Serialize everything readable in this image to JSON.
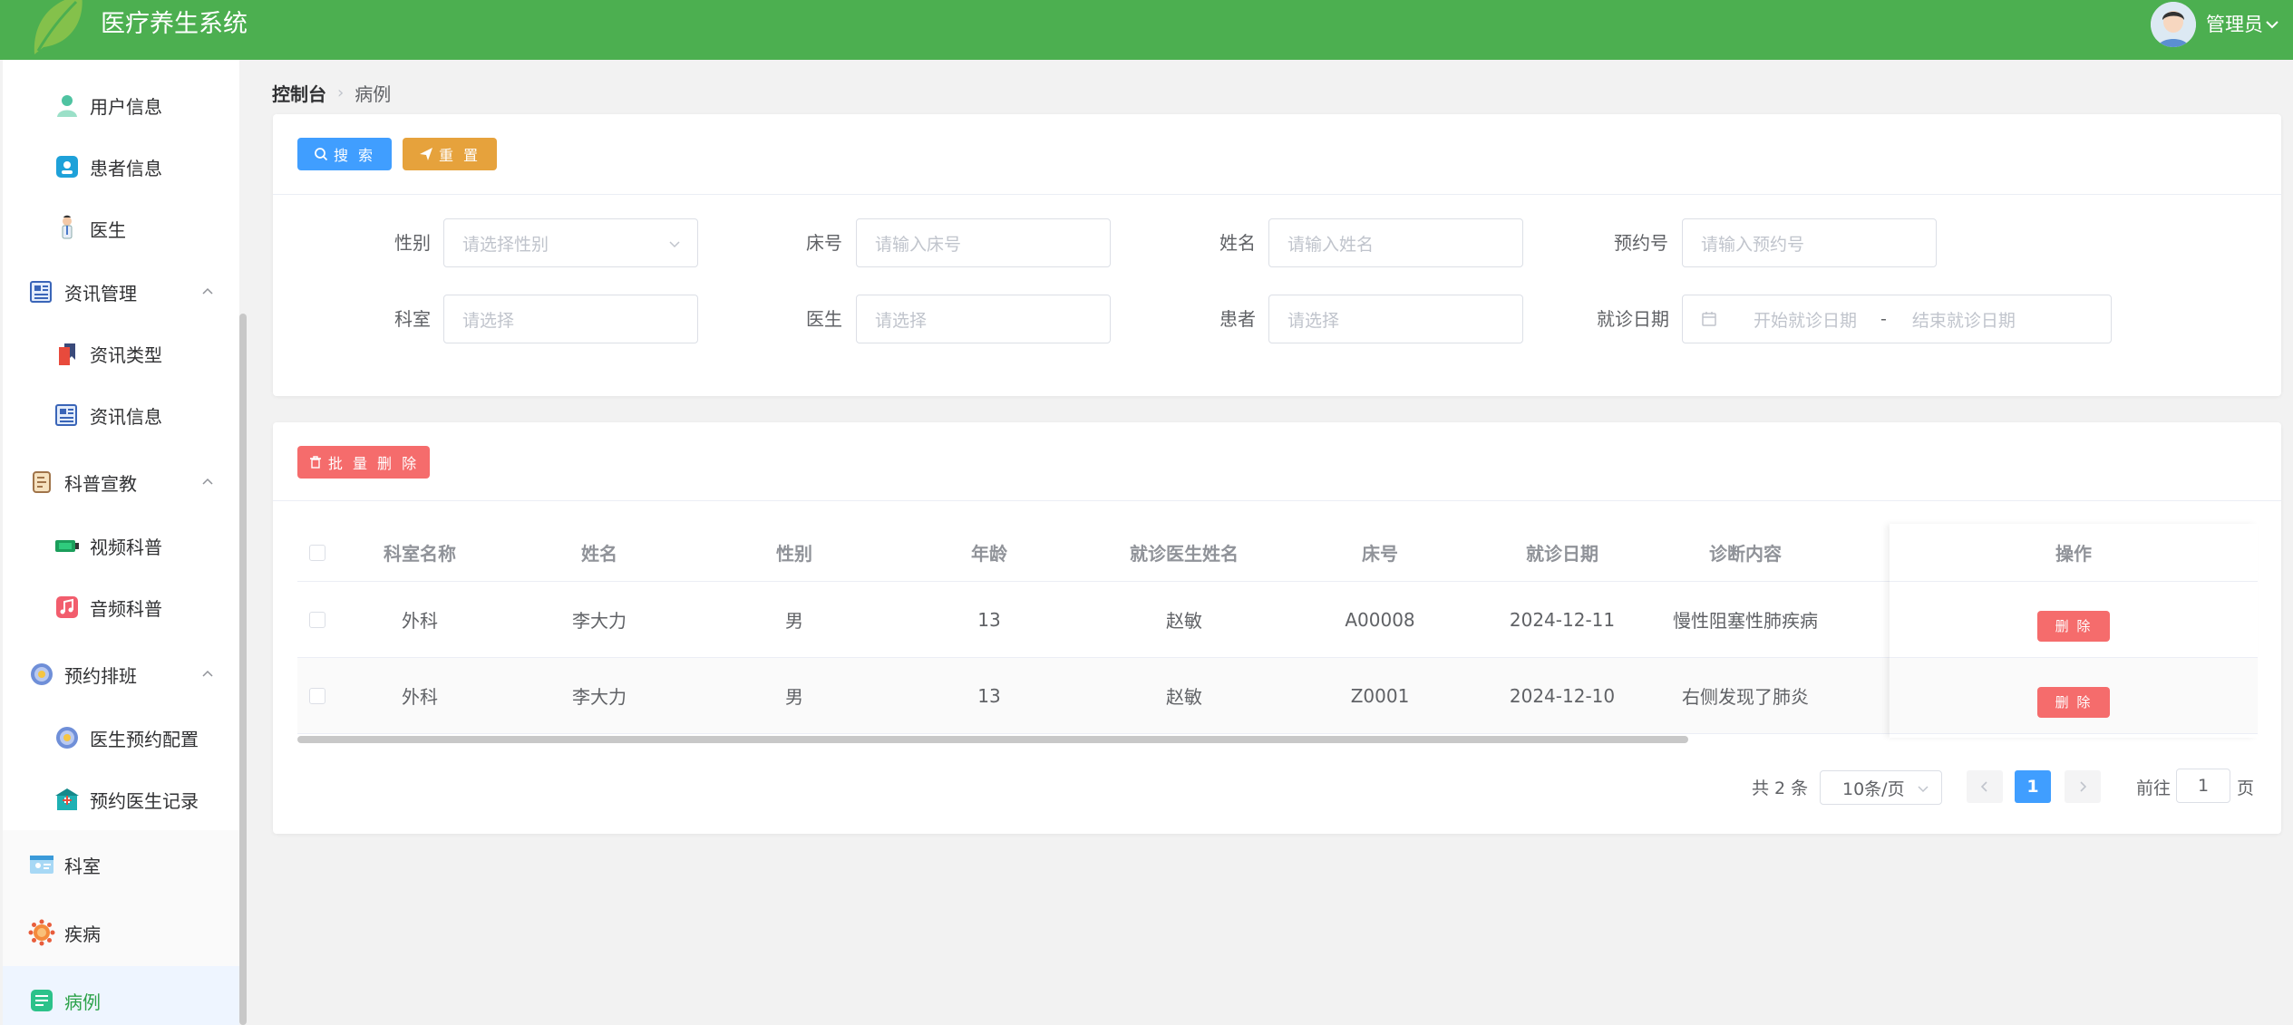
{
  "header": {
    "app_title": "医疗养生系统",
    "user_name": "管理员"
  },
  "sidebar": {
    "items": [
      {
        "label": "用户信息",
        "icon": "user-icon"
      },
      {
        "label": "患者信息",
        "icon": "patient-card-icon"
      },
      {
        "label": "医生",
        "icon": "doctor-icon"
      },
      {
        "label": "资讯管理",
        "icon": "news-icon"
      },
      {
        "label": "资讯类型",
        "icon": "bookmark-icon"
      },
      {
        "label": "资讯信息",
        "icon": "news-icon"
      },
      {
        "label": "科普宣教",
        "icon": "scroll-icon"
      },
      {
        "label": "视频科普",
        "icon": "video-icon"
      },
      {
        "label": "音频科普",
        "icon": "music-icon"
      },
      {
        "label": "预约排班",
        "icon": "gear-icon"
      },
      {
        "label": "医生预约配置",
        "icon": "gear-icon"
      },
      {
        "label": "预约医生记录",
        "icon": "clinic-icon"
      },
      {
        "label": "科室",
        "icon": "department-icon"
      },
      {
        "label": "疾病",
        "icon": "virus-icon"
      },
      {
        "label": "病例",
        "icon": "document-icon"
      }
    ]
  },
  "breadcrumb": {
    "root": "控制台",
    "current": "病例"
  },
  "search": {
    "search_label": "搜 索",
    "reset_label": "重 置",
    "fields": {
      "gender": {
        "label": "性别",
        "placeholder": "请选择性别"
      },
      "bed": {
        "label": "床号",
        "placeholder": "请输入床号"
      },
      "name": {
        "label": "姓名",
        "placeholder": "请输入姓名"
      },
      "appointment": {
        "label": "预约号",
        "placeholder": "请输入预约号"
      },
      "department": {
        "label": "科室",
        "placeholder": "请选择"
      },
      "doctor": {
        "label": "医生",
        "placeholder": "请选择"
      },
      "patient": {
        "label": "患者",
        "placeholder": "请选择"
      },
      "visit_date": {
        "label": "就诊日期",
        "start_placeholder": "开始就诊日期",
        "separator": "-",
        "end_placeholder": "结束就诊日期"
      }
    }
  },
  "table": {
    "batch_delete_label": "批 量 删 除",
    "columns": [
      "科室名称",
      "姓名",
      "性别",
      "年龄",
      "就诊医生姓名",
      "床号",
      "就诊日期",
      "诊断内容",
      "操作"
    ],
    "rows": [
      {
        "department": "外科",
        "name": "李大力",
        "gender": "男",
        "age": "13",
        "doctor": "赵敏",
        "bed": "A00008",
        "date": "2024-12-11",
        "diagnosis": "慢性阻塞性肺疾病",
        "action": "删 除"
      },
      {
        "department": "外科",
        "name": "李大力",
        "gender": "男",
        "age": "13",
        "doctor": "赵敏",
        "bed": "Z0001",
        "date": "2024-12-10",
        "diagnosis": "右侧发现了肺炎",
        "action": "删 除"
      }
    ]
  },
  "pagination": {
    "total": "共 2 条",
    "page_size": "10条/页",
    "current_page": "1",
    "goto_prefix": "前往",
    "goto_value": "1",
    "goto_suffix": "页"
  },
  "colors": {
    "header": "#4caf50",
    "primary": "#409eff",
    "warning": "#e6a23c",
    "danger": "#f56c6c",
    "active_text": "#2ca24a"
  }
}
